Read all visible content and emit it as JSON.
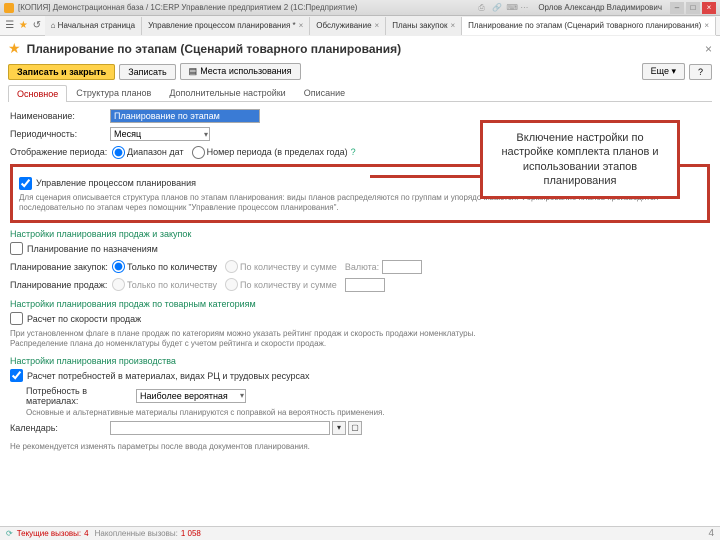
{
  "titlebar": {
    "app_title": "[КОПИЯ] Демонстрационная база / 1С:ERP Управление предприятием 2  (1С:Предприятие)",
    "user": "Орлов Александр Владимирович"
  },
  "toolbar_tabs": [
    {
      "label": "Начальная страница",
      "closable": false
    },
    {
      "label": "Управление процессом планирования *",
      "closable": true
    },
    {
      "label": "Обслуживание",
      "closable": true
    },
    {
      "label": "Планы закупок",
      "closable": true
    },
    {
      "label": "Планирование по этапам (Сценарий товарного планирования)",
      "closable": true,
      "active": true
    }
  ],
  "page": {
    "title": "Планирование по этапам (Сценарий товарного планирования)"
  },
  "buttons": {
    "save_close": "Записать и закрыть",
    "save": "Записать",
    "usage": "Места использования",
    "more": "Еще"
  },
  "pagetabs": [
    "Основное",
    "Структура планов",
    "Дополнительные настройки",
    "Описание"
  ],
  "pagetab_active": 0,
  "form": {
    "name_label": "Наименование:",
    "name_value": "Планирование по этапам",
    "period_label": "Периодичность:",
    "period_value": "Месяц",
    "display_label": "Отображение периода:",
    "display_opts": [
      "Диапазон дат",
      "Номер периода (в пределах года)"
    ],
    "redbox": {
      "check_label": "Управление процессом планирования",
      "desc": "Для сценария описывается структура планов по этапам планирования: виды планов распределяются по группам и упорядочиваются. Формирование планов производится последовательно по этапам через помощник \"Управление процессом планирования\"."
    },
    "sec_sales_plan": "Настройки планирования продаж и закупок",
    "plan_by_assign": "Планирование по назначениям",
    "plan_purchase_label": "Планирование закупок:",
    "plan_sales_label": "Планирование продаж:",
    "opt_qty": "Только по количеству",
    "opt_qty_sum": "По количеству и сумме",
    "valuta": "Валюта:",
    "sec_cat": "Настройки планирования продаж по товарным категориям",
    "speed_check": "Расчет по скорости продаж",
    "speed_desc": "При установленном флаге в плане продаж по категориям можно указать рейтинг продаж и скорость продажи номенклатуры.\nРаспределение плана до номенклатуры будет с учетом рейтинга и скорости продаж.",
    "sec_prod": "Настройки планирования производства",
    "mat_check": "Расчет потребностей в материалах, видах РЦ и трудовых ресурсах",
    "mat_label": "Потребность в материалах:",
    "mat_value": "Наиболее вероятная",
    "mat_desc": "Основные и альтернативные материалы планируются с поправкой на вероятность применения.",
    "cal_label": "Календарь:",
    "footer_note": "Не рекомендуется изменять параметры после ввода документов планирования."
  },
  "callout": "Включение настройки по настройке комплекта планов и использовании этапов планирования",
  "status": {
    "current_label": "Текущие вызовы:",
    "current_val": "4",
    "acc_label": "Накопленные вызовы:",
    "acc_val": "1 058"
  },
  "slide_num": "4"
}
